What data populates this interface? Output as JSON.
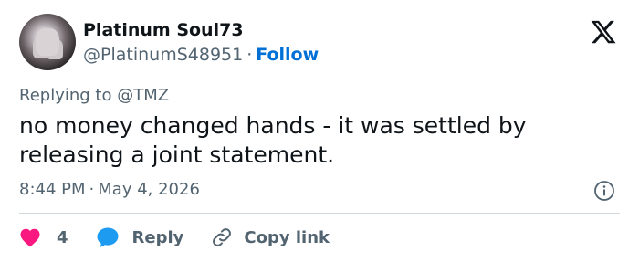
{
  "author": {
    "display_name": "Platinum Soul73",
    "handle": "@PlatinumS48951",
    "separator": "·",
    "follow_label": "Follow",
    "avatar": "avatar-hand-image"
  },
  "brand": {
    "logo": "x-logo-icon"
  },
  "tweet": {
    "replying_prefix": "Replying to",
    "replying_to": "@TMZ",
    "text": "no money changed hands - it was settled by releasing a joint statement.",
    "time": "8:44 PM",
    "date": "May 4, 2026",
    "separator": "·",
    "info_icon": "info-icon"
  },
  "actions": {
    "like_count": "4",
    "reply_label": "Reply",
    "copy_link_label": "Copy link"
  },
  "colors": {
    "heart": "#f91880",
    "reply_bubble": "#1d9bf0",
    "follow": "#006fd6",
    "secondary_text": "#536471",
    "divider": "#cfd9de"
  }
}
